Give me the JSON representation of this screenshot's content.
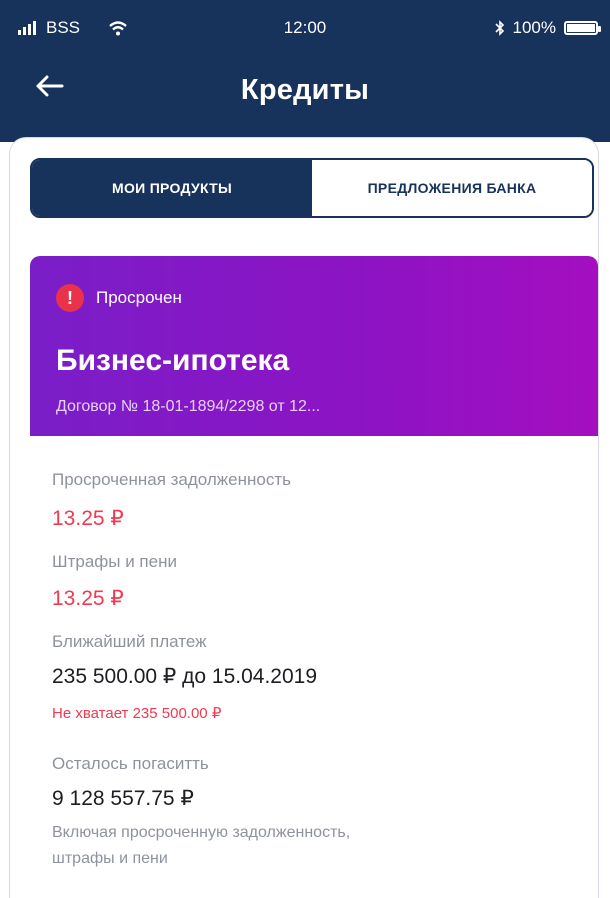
{
  "status_bar": {
    "carrier": "BSS",
    "time": "12:00",
    "battery": "100%"
  },
  "header": {
    "title": "Кредиты"
  },
  "tabs": [
    {
      "label": "МОИ ПРОДУКТЫ",
      "active": true
    },
    {
      "label": "ПРЕДЛОЖЕНИЯ БАНКА",
      "active": false
    }
  ],
  "loan_card": {
    "status": "Просрочен",
    "title": "Бизнес-ипотека",
    "contract": "Договор № 18-01-1894/2298 от 12..."
  },
  "details": {
    "overdue_label": "Просроченная задолженность",
    "overdue_value": "13.25 ₽",
    "penalties_label": "Штрафы и пени",
    "penalties_value": "13.25 ₽",
    "next_payment_label": "Ближайший платеж",
    "next_payment_value": "235 500.00 ₽ до 15.04.2019",
    "shortfall": "Не хватает 235 500.00 ₽",
    "remaining_label": "Осталось погаситть",
    "remaining_value": "9 128 557.75 ₽",
    "remaining_note_1": "Включая просроченную задолженность,",
    "remaining_note_2": "штрафы и пени"
  },
  "colors": {
    "header_bg": "#17325b",
    "card_gradient_start": "#7a1ec8",
    "card_gradient_end": "#a40fc0",
    "alert": "#f03a4f"
  }
}
